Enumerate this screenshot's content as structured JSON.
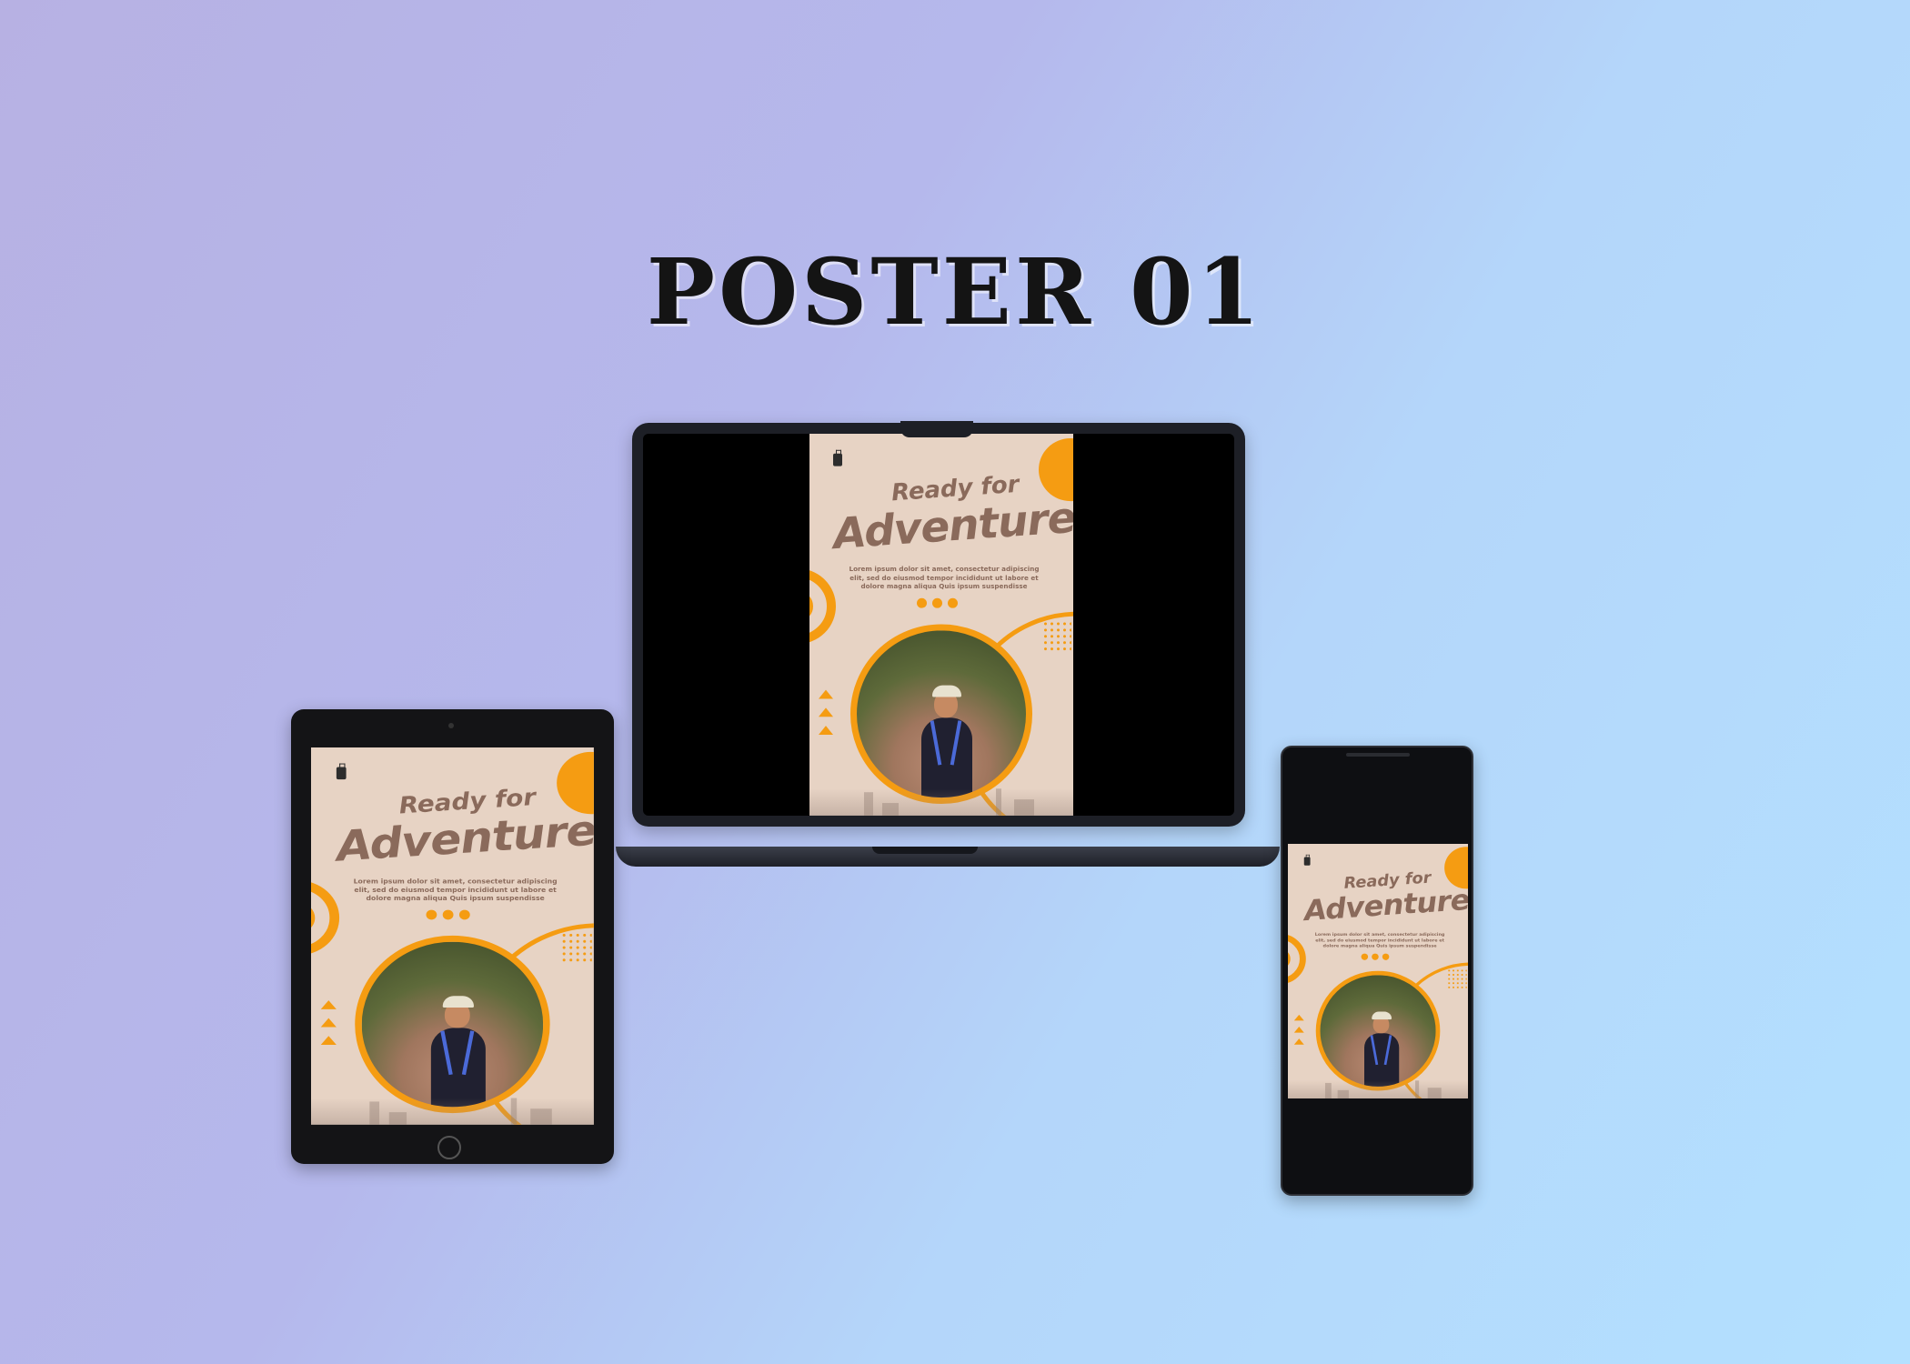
{
  "page": {
    "title": "POSTER 01"
  },
  "poster": {
    "headline_small": "Ready for",
    "headline_large": "Adventure",
    "body_text": "Lorem ipsum dolor sit amet, consectetur adipiscing elit, sed do eiusmod tempor incididunt ut labore et dolore magna aliqua Quis ipsum suspendisse",
    "social_icons": [
      "twitter-icon",
      "facebook-icon",
      "instagram-icon"
    ],
    "colors": {
      "background": "#e7d3c4",
      "accent": "#f59c12",
      "headline": "#8a6a5b"
    }
  },
  "devices": [
    "laptop",
    "tablet",
    "phone"
  ]
}
